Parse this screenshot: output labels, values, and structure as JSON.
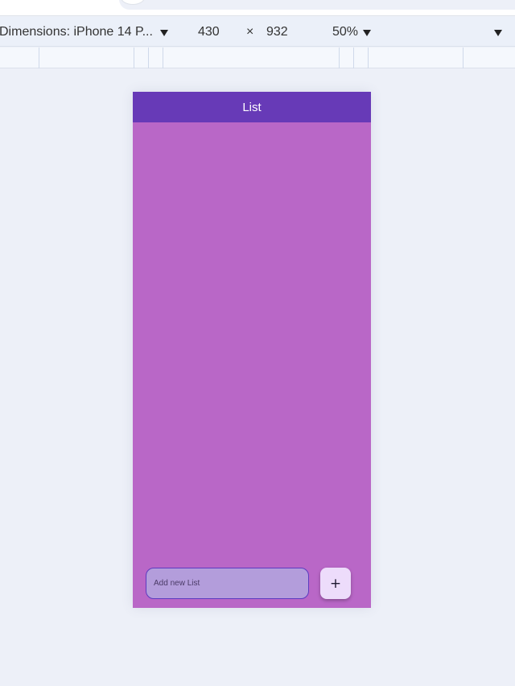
{
  "toolbar": {
    "device_label": "Dimensions: iPhone 14 P...",
    "width": "430",
    "times": "×",
    "height": "932",
    "zoom": "50%"
  },
  "app": {
    "title": "List",
    "input_placeholder": "Add new List",
    "add_label": "+"
  },
  "colors": {
    "app_bar": "#673ab7",
    "body": "#b967c7",
    "input_bg": "#b39ddb",
    "add_button_bg": "#eddcfb"
  }
}
